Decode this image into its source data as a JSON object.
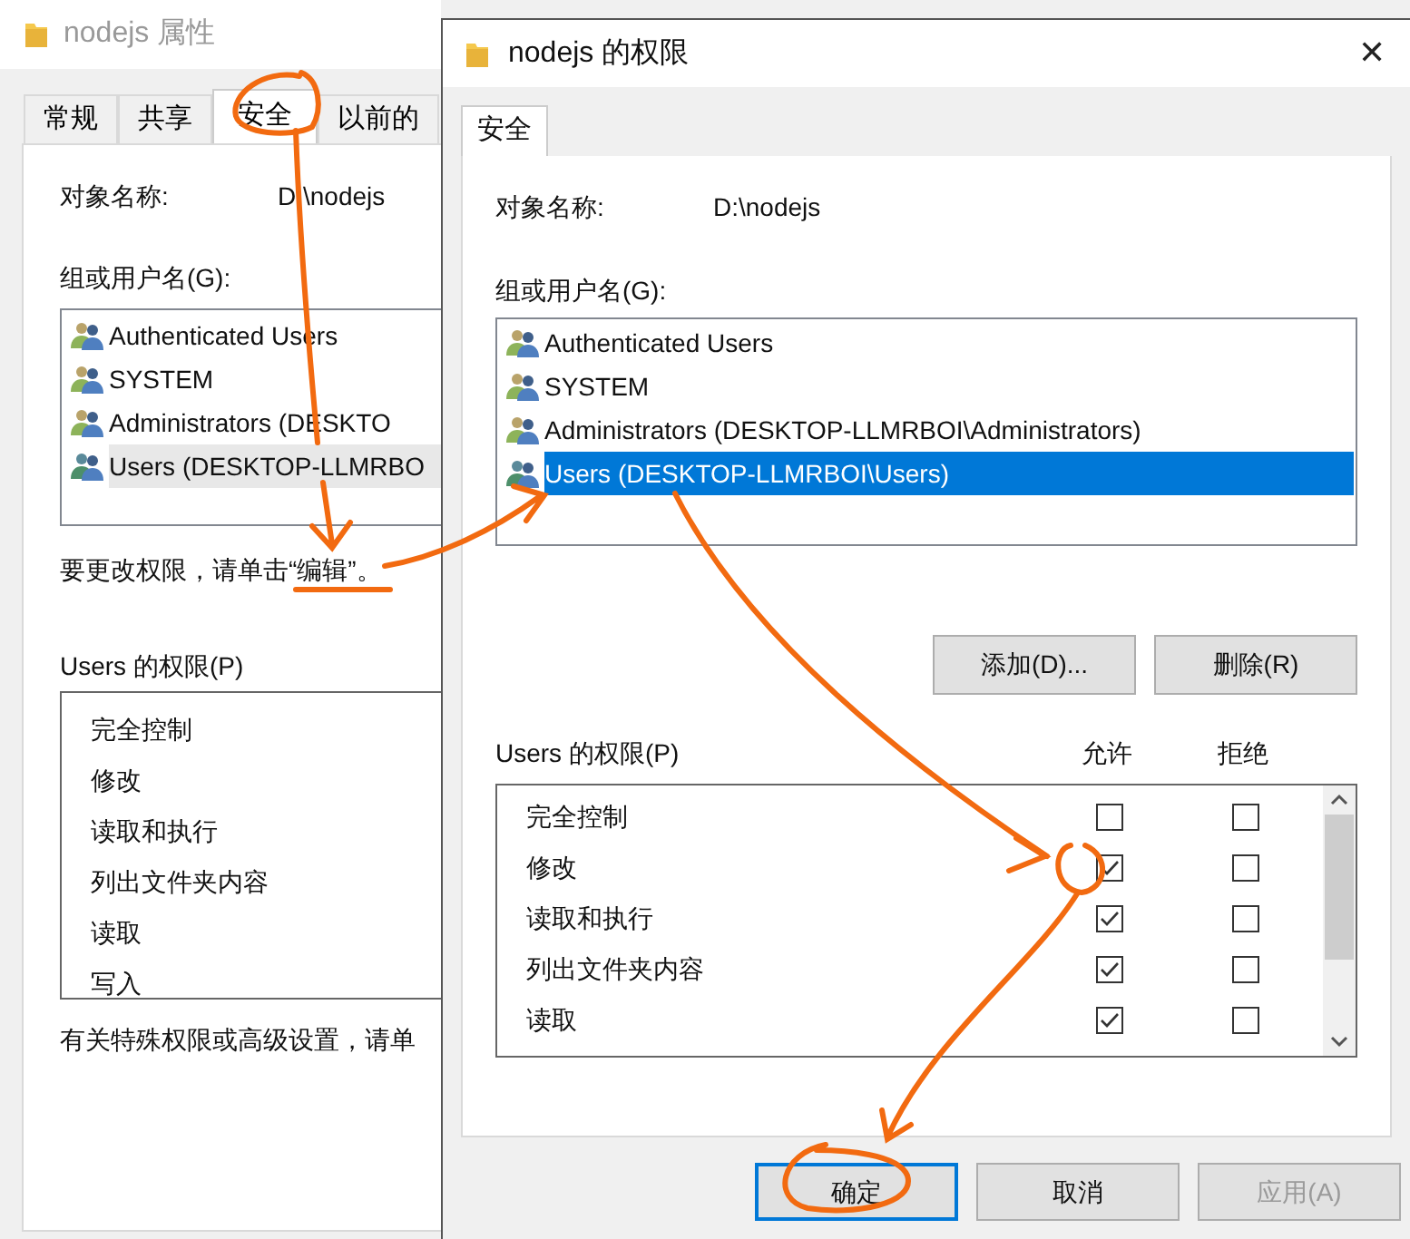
{
  "background_window": {
    "title": "nodejs 属性",
    "tabs": [
      {
        "label": "常规",
        "selected": false
      },
      {
        "label": "共享",
        "selected": false
      },
      {
        "label": "安全",
        "selected": true
      },
      {
        "label": "以前的",
        "selected": false
      }
    ],
    "object_name_label": "对象名称:",
    "object_name": "D:\\nodejs",
    "groups_label": "组或用户名(G):",
    "groups": [
      {
        "name": "Authenticated Users",
        "selected": false
      },
      {
        "name": "SYSTEM",
        "selected": false
      },
      {
        "name": "Administrators (DESKTO",
        "selected": false
      },
      {
        "name": "Users (DESKTOP-LLMRBO",
        "selected": true
      }
    ],
    "edit_hint": "要更改权限，请单击“编辑”。",
    "permissions_label": "Users 的权限(P)",
    "permissions": [
      "完全控制",
      "修改",
      "读取和执行",
      "列出文件夹内容",
      "读取",
      "写入"
    ],
    "advanced_hint": "有关特殊权限或高级设置，请单"
  },
  "dialog": {
    "title": "nodejs 的权限",
    "close": "✕",
    "tabs": [
      {
        "label": "安全",
        "selected": true
      }
    ],
    "object_name_label": "对象名称:",
    "object_name": "D:\\nodejs",
    "groups_label": "组或用户名(G):",
    "groups": [
      {
        "name": "Authenticated Users",
        "selected": false
      },
      {
        "name": "SYSTEM",
        "selected": false
      },
      {
        "name": "Administrators (DESKTOP-LLMRBOI\\Administrators)",
        "selected": false
      },
      {
        "name": "Users (DESKTOP-LLMRBOI\\Users)",
        "selected": true
      }
    ],
    "group_buttons": [
      "添加(D)...",
      "删除(R)"
    ],
    "permissions_label": "Users 的权限(P)",
    "allow_header": "允许",
    "deny_header": "拒绝",
    "permissions": [
      {
        "name": "完全控制",
        "allow": false,
        "deny": false
      },
      {
        "name": "修改",
        "allow": true,
        "deny": false
      },
      {
        "name": "读取和执行",
        "allow": true,
        "deny": false
      },
      {
        "name": "列出文件夹内容",
        "allow": true,
        "deny": false
      },
      {
        "name": "读取",
        "allow": true,
        "deny": false
      }
    ],
    "buttons": [
      {
        "label": "确定",
        "default": true,
        "disabled": false
      },
      {
        "label": "取消",
        "default": false,
        "disabled": false
      },
      {
        "label": "应用(A)",
        "default": false,
        "disabled": true
      }
    ]
  }
}
